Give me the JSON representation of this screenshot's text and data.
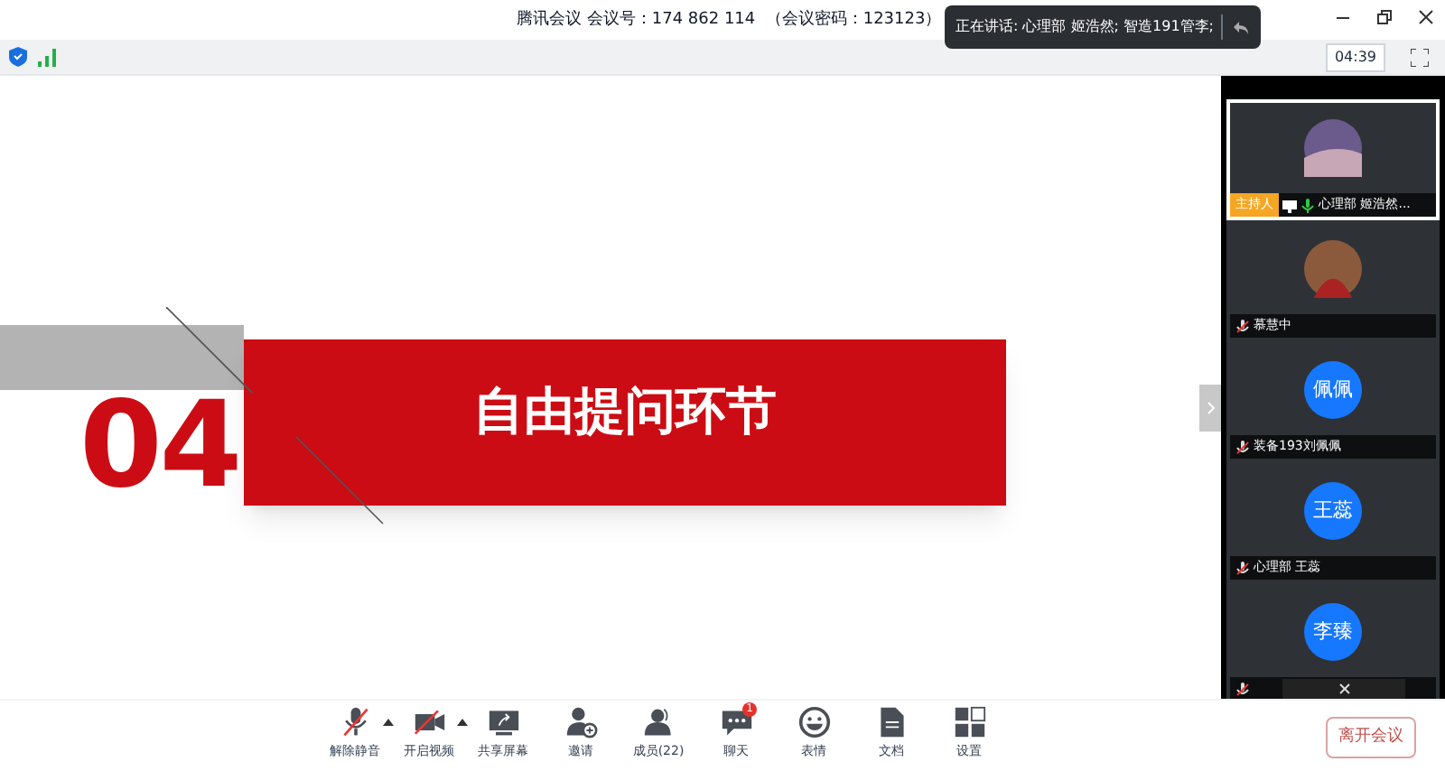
{
  "window": {
    "title": "腾讯会议 会议号：174 862 114  （会议密码：123123）"
  },
  "speaking_toast": {
    "text": "正在讲话: 心理部 姬浩然; 智造191管李;"
  },
  "timer": "04:39",
  "slide": {
    "number": "04",
    "heading": "自由提问环节"
  },
  "participants": [
    {
      "name": "心理部 姬浩然...",
      "kind": "photo",
      "host_badge": "主持人",
      "selected": true,
      "muted": false
    },
    {
      "name": "慕慧中",
      "kind": "photo",
      "selected": false,
      "muted": true
    },
    {
      "name": "装备193刘佩佩",
      "kind": "initials",
      "avatar_text": "佩佩",
      "selected": false,
      "muted": true
    },
    {
      "name": "心理部 王蕊",
      "kind": "initials",
      "avatar_text": "王蕊",
      "selected": false,
      "muted": true
    },
    {
      "kind": "initials",
      "avatar_text": "李臻",
      "selected": false,
      "muted": true
    }
  ],
  "toolbar": [
    {
      "kind": "mic",
      "label": "解除静音",
      "menu": true
    },
    {
      "kind": "video",
      "label": "开启视频",
      "menu": true
    },
    {
      "kind": "share",
      "label": "共享屏幕",
      "menu": false
    },
    {
      "kind": "invite",
      "label": "邀请",
      "menu": false
    },
    {
      "kind": "members",
      "label": "成员(22)",
      "menu": false
    },
    {
      "kind": "chat",
      "label": "聊天",
      "menu": false,
      "badge": "1"
    },
    {
      "kind": "emoji",
      "label": "表情",
      "menu": false
    },
    {
      "kind": "doc",
      "label": "文档",
      "menu": false
    },
    {
      "kind": "settings",
      "label": "设置",
      "menu": false
    }
  ],
  "leave_button": "离开会议"
}
